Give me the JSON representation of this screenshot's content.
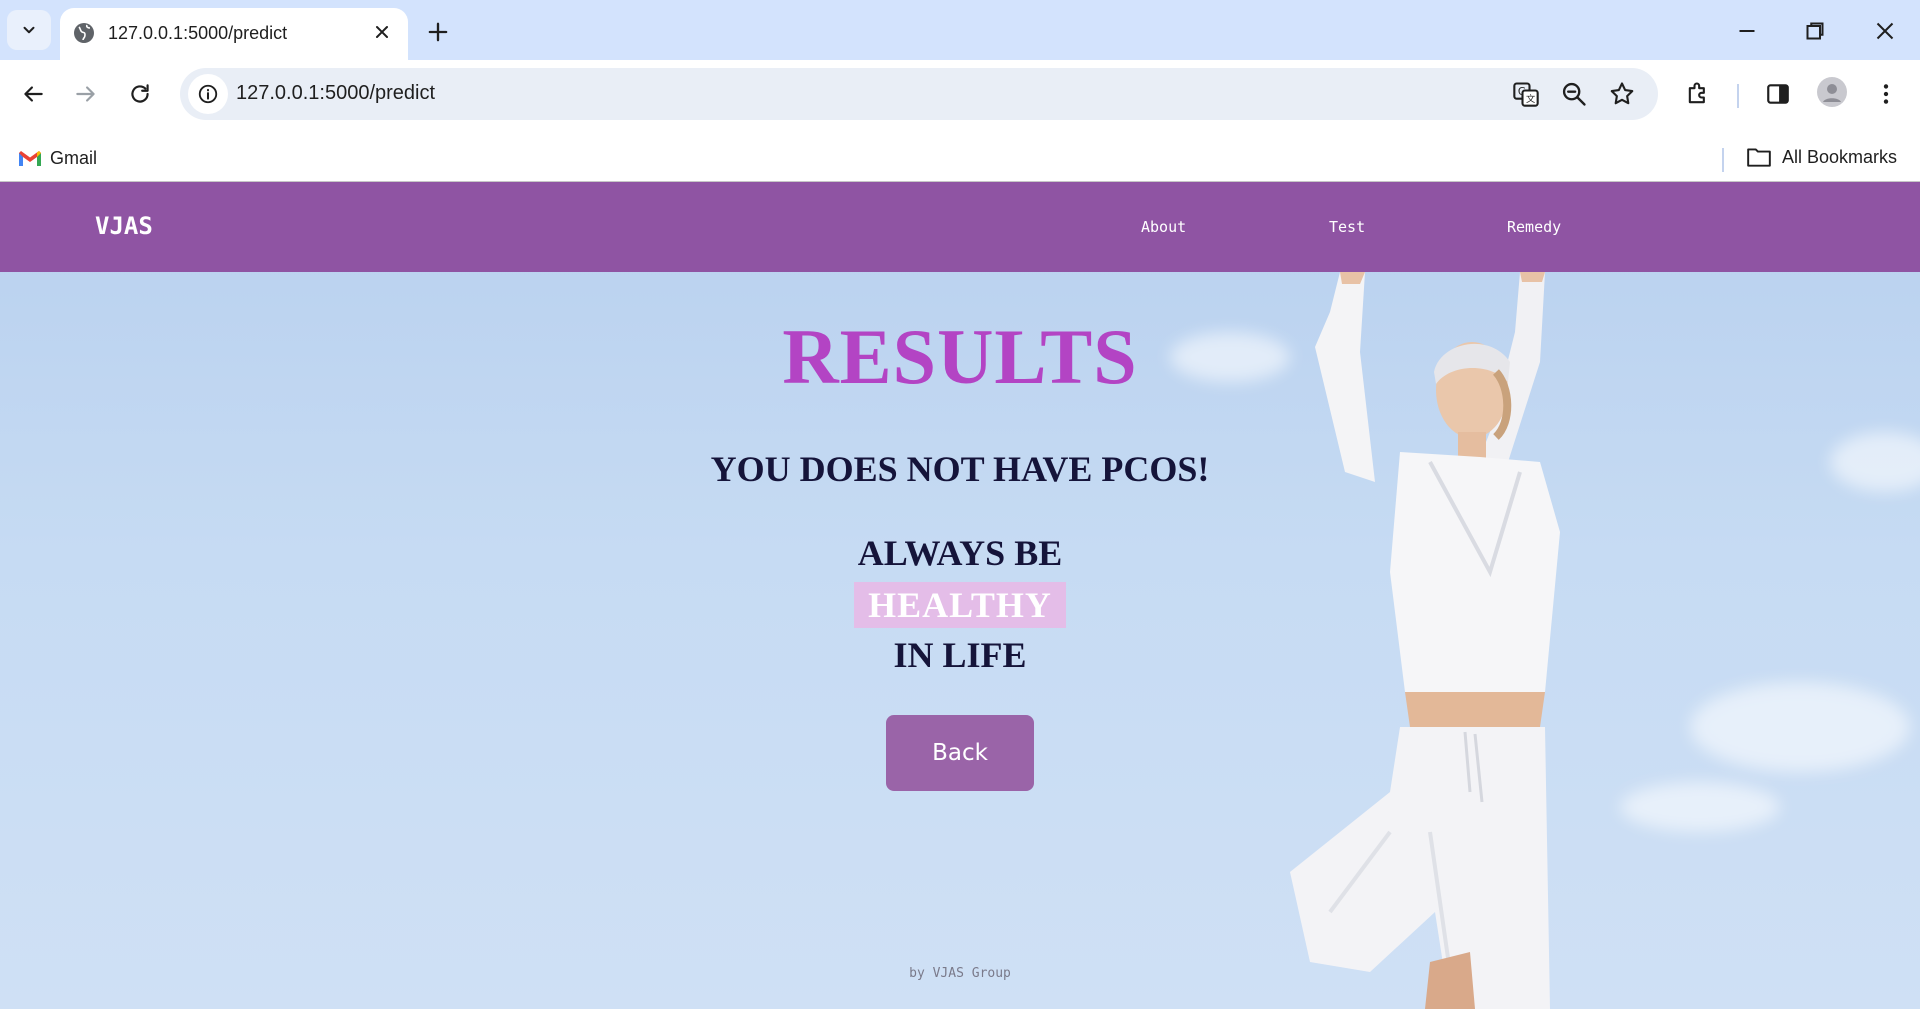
{
  "browser": {
    "tab_title": "127.0.0.1:5000/predict",
    "url": "127.0.0.1:5000/predict",
    "bookmarks": {
      "gmail": "Gmail",
      "all_bookmarks": "All Bookmarks"
    }
  },
  "site": {
    "brand": "VJAS",
    "nav": [
      "About",
      "Test",
      "Remedy"
    ],
    "accent_color": "#8f54a3"
  },
  "result": {
    "heading": "RESULTS",
    "verdict": "YOU DOES NOT HAVE PCOS!",
    "line1": "ALWAYS BE",
    "highlight": "HEALTHY",
    "line3": "IN LIFE",
    "back_label": "Back"
  },
  "footer": {
    "text": "by VJAS Group"
  }
}
